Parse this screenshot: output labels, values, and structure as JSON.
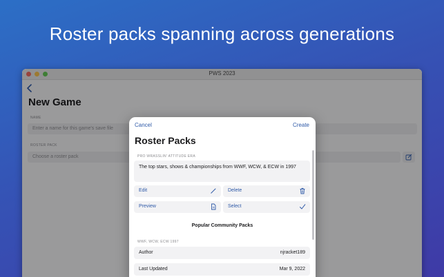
{
  "headline": "Roster packs spanning across generations",
  "window": {
    "title": "PWS 2023",
    "page_title": "New Game",
    "name_label": "NAME",
    "name_placeholder": "Enter a name for this game's save file",
    "roster_label": "ROSTER PACK",
    "roster_placeholder": "Choose a roster pack"
  },
  "sheet": {
    "cancel": "Cancel",
    "create": "Create",
    "title": "Roster Packs",
    "era_header": "PRO WRASSLIN' ATTITUDE ERA",
    "description": "The top stars, shows & championships from WWF, WCW, & ECW in 1997",
    "actions": {
      "edit": "Edit",
      "delete": "Delete",
      "preview": "Preview",
      "select": "Select"
    },
    "community_header": "Popular Community Packs",
    "community_section": "WWF, WCW, ECW 1997",
    "rows": [
      {
        "key": "Author",
        "value": "njracket189"
      },
      {
        "key": "Last Updated",
        "value": "Mar 9, 2022"
      }
    ]
  },
  "colors": {
    "accent": "#2f5aa8",
    "gradient_top": "#2c6fc6",
    "gradient_bottom": "#3f3aa6"
  },
  "icons": [
    "chevron-left-icon",
    "pencil-icon",
    "trash-icon",
    "document-icon",
    "checkmark-icon",
    "edit-square-icon"
  ]
}
